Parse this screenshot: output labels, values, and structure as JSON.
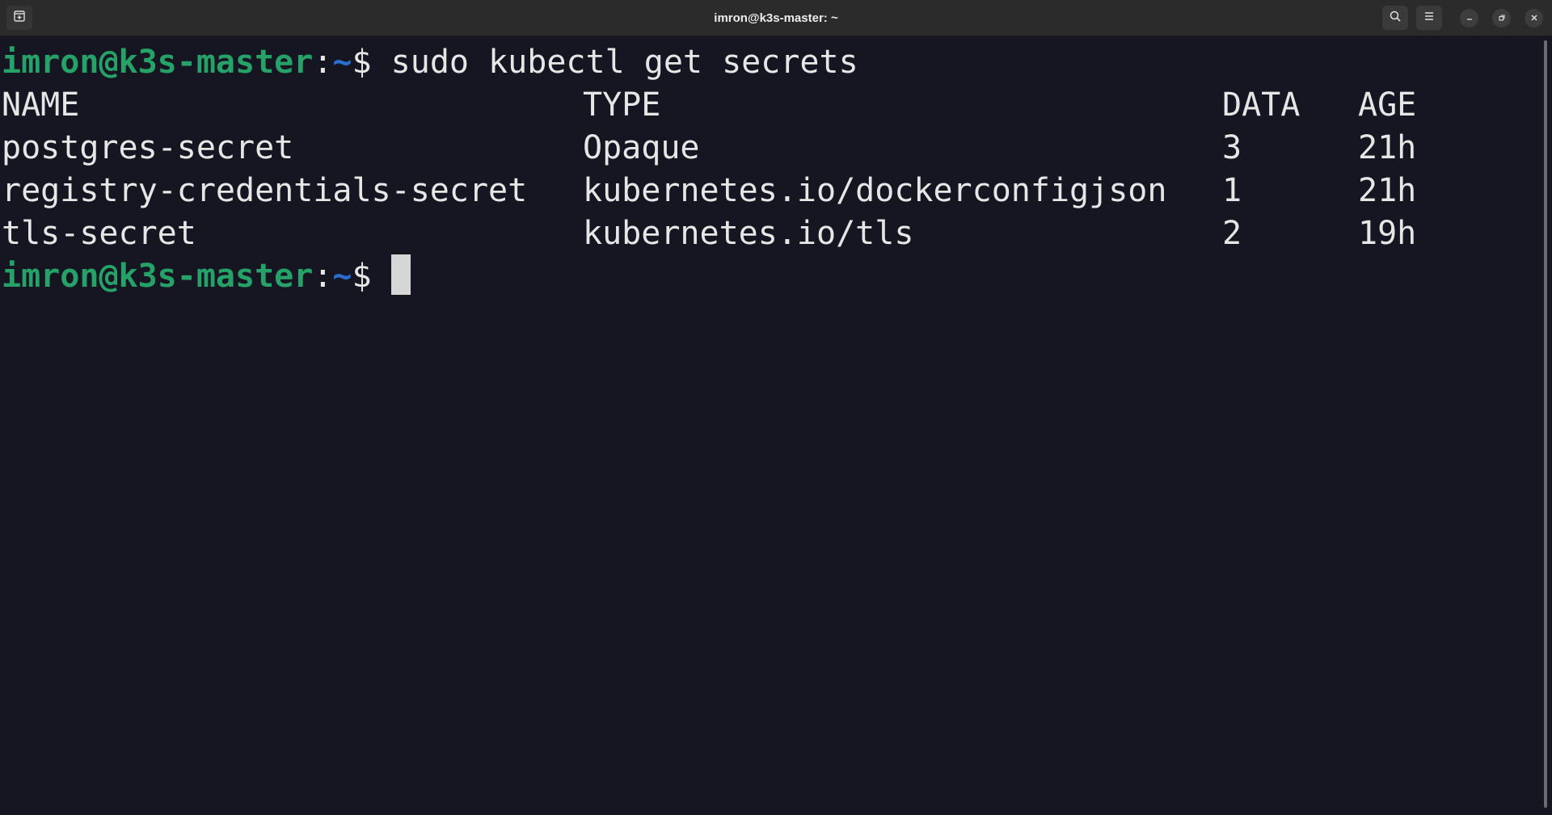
{
  "window": {
    "title": "imron@k3s-master: ~",
    "icons": {
      "new_tab": "new-tab-icon",
      "search": "search-icon",
      "menu": "hamburger-menu-icon",
      "minimize": "minimize-icon",
      "maximize": "restore-icon",
      "close": "close-icon"
    }
  },
  "terminal": {
    "prompt": {
      "user_host": "imron@k3s-master",
      "colon": ":",
      "path": "~",
      "dollar": "$"
    },
    "command": " sudo kubectl get secrets",
    "table": {
      "headers": {
        "name": "NAME",
        "type": "TYPE",
        "data": "DATA",
        "age": "AGE"
      },
      "rows": [
        {
          "name": "postgres-secret",
          "type": "Opaque",
          "data": "3",
          "age": "21h"
        },
        {
          "name": "registry-credentials-secret",
          "type": "kubernetes.io/dockerconfigjson",
          "data": "1",
          "age": "21h"
        },
        {
          "name": "tls-secret",
          "type": "kubernetes.io/tls",
          "data": "2",
          "age": "19h"
        }
      ]
    },
    "colors": {
      "background": "#161622",
      "foreground": "#e6e6e6",
      "prompt_user": "#26a269",
      "prompt_path": "#2a6fd0"
    }
  }
}
